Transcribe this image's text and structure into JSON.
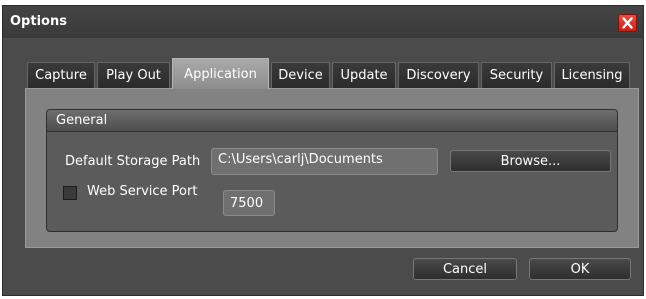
{
  "window": {
    "title": "Options"
  },
  "tabs": [
    {
      "label": "Capture"
    },
    {
      "label": "Play Out"
    },
    {
      "label": "Application",
      "active": true
    },
    {
      "label": "Device"
    },
    {
      "label": "Update"
    },
    {
      "label": "Discovery"
    },
    {
      "label": "Security"
    },
    {
      "label": "Licensing"
    }
  ],
  "general": {
    "title": "General",
    "storage_label": "Default Storage Path",
    "storage_value": "C:\\Users\\carlj\\Documents",
    "browse_label": "Browse...",
    "web_service_label": "Web Service Port",
    "web_service_checked": false,
    "web_service_port": "7500"
  },
  "footer": {
    "cancel_label": "Cancel",
    "ok_label": "OK"
  },
  "colors": {
    "close_button": "#e0301e",
    "active_tab": "#9c9c9c",
    "background": "#4b4b4b"
  },
  "icons": {
    "close": "close-icon"
  }
}
